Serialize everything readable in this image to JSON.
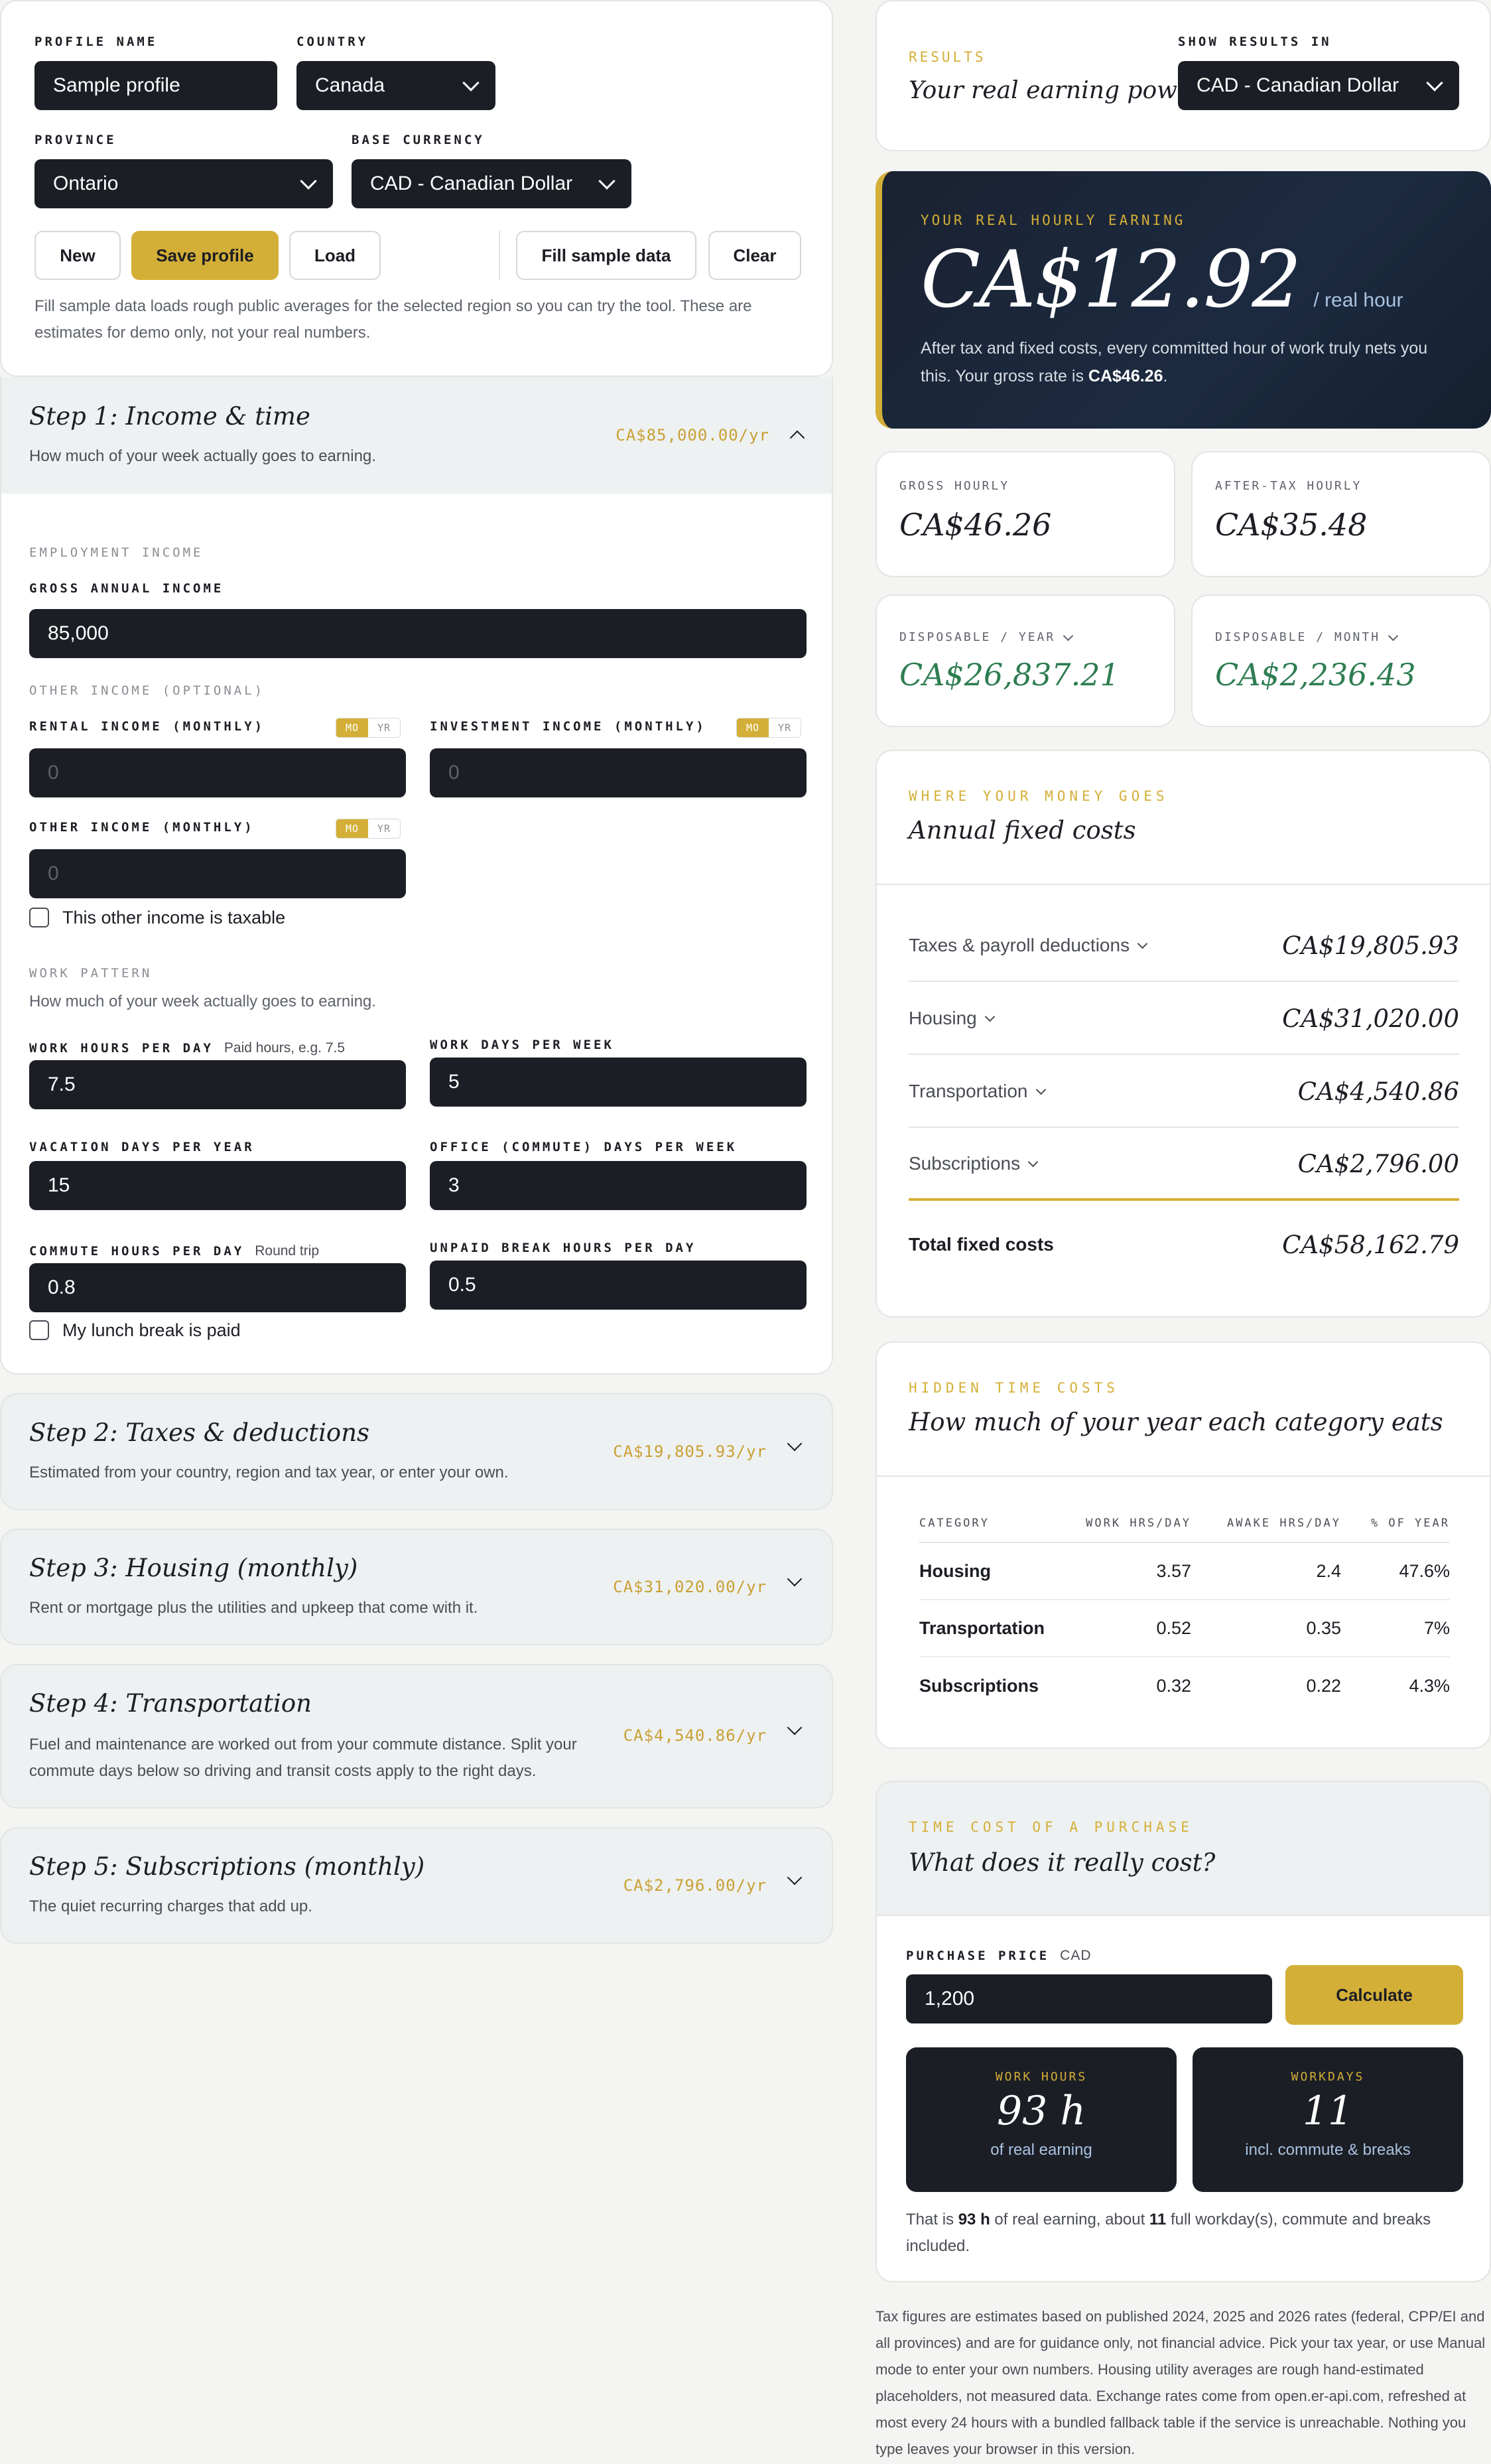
{
  "profile": {
    "profile_name_label": "Profile name",
    "profile_name_value": "Sample profile",
    "country_label": "Country",
    "country_value": "Canada",
    "province_label": "Province",
    "province_value": "Ontario",
    "base_currency_label": "Base currency",
    "base_currency_value": "CAD - Canadian Dollar",
    "buttons": {
      "new": "New",
      "save": "Save profile",
      "load": "Load",
      "fill": "Fill sample data",
      "clear": "Clear"
    },
    "note": "Fill sample data loads rough public averages for the selected region so you can try the tool. These are estimates for demo only, not your real numbers."
  },
  "step1": {
    "title": "Step 1: Income & time",
    "subtitle": "How much of your week actually goes to earning.",
    "amount": "CA$85,000.00/yr",
    "employment_section": "Employment income",
    "gross_label": "Gross annual income",
    "gross_value": "85,000",
    "other_section": "Other income (optional)",
    "rental_label": "Rental income (monthly)",
    "rental_value": "0",
    "investment_label": "Investment income (monthly)",
    "investment_value": "0",
    "other_label": "Other income (monthly)",
    "other_value": "0",
    "toggle_mo": "MO",
    "toggle_yr": "YR",
    "taxable_label": "This other income is taxable",
    "work_section": "Work pattern",
    "work_sub": "How much of your week actually goes to earning.",
    "hours_label": "Work hours per day",
    "hours_hint": "Paid hours, e.g. 7.5",
    "hours_value": "7.5",
    "days_label": "Work days per week",
    "days_value": "5",
    "vacation_label": "Vacation days per year",
    "vacation_value": "15",
    "office_label": "Office (commute) days per week",
    "office_value": "3",
    "commute_label": "Commute hours per day",
    "commute_hint": "Round trip",
    "commute_value": "0.8",
    "break_label": "Unpaid break hours per day",
    "break_value": "0.5",
    "lunch_label": "My lunch break is paid"
  },
  "steps": [
    {
      "title": "Step 2: Taxes & deductions",
      "subtitle": "Estimated from your country, region and tax year, or enter your own.",
      "amount": "CA$19,805.93/yr"
    },
    {
      "title": "Step 3: Housing (monthly)",
      "subtitle": "Rent or mortgage plus the utilities and upkeep that come with it.",
      "amount": "CA$31,020.00/yr"
    },
    {
      "title": "Step 4: Transportation",
      "subtitle": "Fuel and maintenance are worked out from your commute distance. Split your commute days below so driving and transit costs apply to the right days.",
      "amount": "CA$4,540.86/yr"
    },
    {
      "title": "Step 5: Subscriptions (monthly)",
      "subtitle": "The quiet recurring charges that add up.",
      "amount": "CA$2,796.00/yr"
    }
  ],
  "results": {
    "eyebrow": "Results",
    "title": "Your real earning power",
    "show_label": "Show results in",
    "show_value": "CAD - Canadian Dollar"
  },
  "hero": {
    "eyebrow": "Your real hourly earning",
    "value": "CA$12.92",
    "unit": "/ real hour",
    "desc_pre": "After tax and fixed costs, every committed hour of work truly nets you this. Your gross rate is ",
    "desc_strong": "CA$46.26",
    "desc_post": "."
  },
  "stats": [
    {
      "label": "Gross hourly",
      "value": "CA$46.26"
    },
    {
      "label": "After-tax hourly",
      "value": "CA$35.48"
    },
    {
      "label": "Disposable / year",
      "value": "CA$26,837.21"
    },
    {
      "label": "Disposable / month",
      "value": "CA$2,236.43"
    }
  ],
  "fixed": {
    "eyebrow": "Where your money goes",
    "title": "Annual fixed costs",
    "rows": [
      {
        "label": "Taxes & payroll deductions",
        "value": "CA$19,805.93"
      },
      {
        "label": "Housing",
        "value": "CA$31,020.00"
      },
      {
        "label": "Transportation",
        "value": "CA$4,540.86"
      },
      {
        "label": "Subscriptions",
        "value": "CA$2,796.00"
      }
    ],
    "total_label": "Total fixed costs",
    "total_value": "CA$58,162.79"
  },
  "hidden": {
    "eyebrow": "Hidden time costs",
    "title": "How much of your year each category eats",
    "headers": [
      "Category",
      "Work hrs/day",
      "Awake hrs/day",
      "% of year"
    ],
    "rows": [
      [
        "Housing",
        "3.57",
        "2.4",
        "47.6%"
      ],
      [
        "Transportation",
        "0.52",
        "0.35",
        "7%"
      ],
      [
        "Subscriptions",
        "0.32",
        "0.22",
        "4.3%"
      ]
    ]
  },
  "purchase": {
    "eyebrow": "Time cost of a purchase",
    "title": "What does it really cost?",
    "price_label": "Purchase price",
    "price_unit": "CAD",
    "price_value": "1,200",
    "calc": "Calculate",
    "work_label": "Work hours",
    "work_value": "93 h",
    "work_sub": "of real earning",
    "days_label": "Workdays",
    "days_value": "11",
    "days_sub": "incl. commute & breaks",
    "summary_1": "That is ",
    "summary_2": "93 h",
    "summary_3": " of real earning, about ",
    "summary_4": "11",
    "summary_5": " full workday(s), commute and breaks included."
  },
  "disclaimer": "Tax figures are estimates based on published 2024, 2025 and 2026 rates (federal, CPP/EI and all provinces) and are for guidance only, not financial advice. Pick your tax year, or use Manual mode to enter your own numbers. Housing utility averages are rough hand-estimated placeholders, not measured data. Exchange rates come from open.er-api.com, refreshed at most every 24 hours with a bundled fallback table if the service is unreachable. Nothing you type leaves your browser in this version.",
  "colors": {
    "gold": "#d4af37",
    "dark": "#1c1e26",
    "green": "#2e7d52",
    "hero_bg": "#1a2536"
  }
}
